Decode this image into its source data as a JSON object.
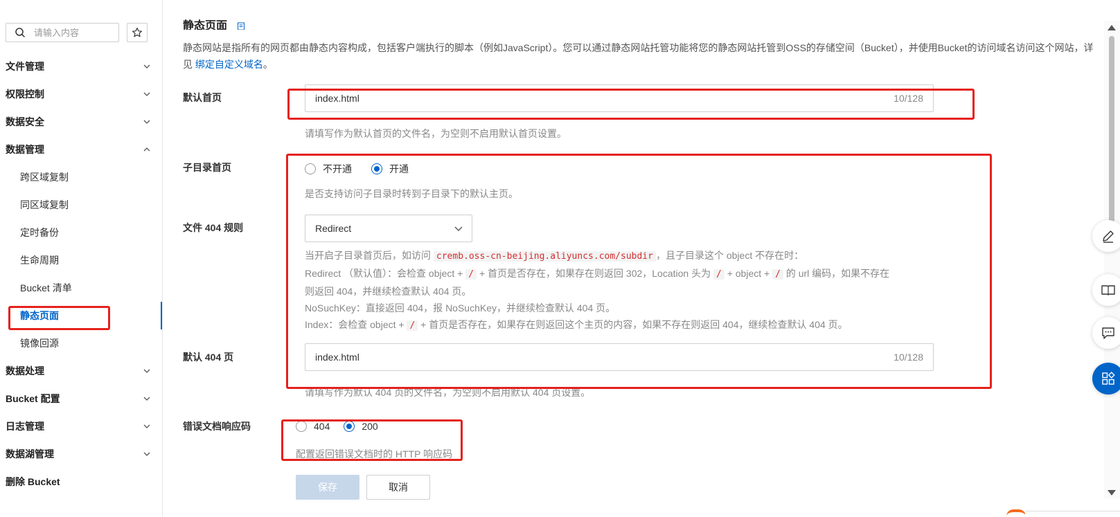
{
  "sidebar": {
    "search_placeholder": "请输入内容",
    "items": [
      {
        "label": "文件管理"
      },
      {
        "label": "权限控制"
      },
      {
        "label": "数据安全"
      },
      {
        "label": "数据管理"
      },
      {
        "label": "数据处理"
      },
      {
        "label": "Bucket 配置"
      },
      {
        "label": "日志管理"
      },
      {
        "label": "数据湖管理"
      },
      {
        "label": "删除 Bucket"
      }
    ],
    "sub_items": [
      {
        "label": "跨区域复制"
      },
      {
        "label": "同区域复制"
      },
      {
        "label": "定时备份"
      },
      {
        "label": "生命周期"
      },
      {
        "label": "Bucket 清单"
      },
      {
        "label": "静态页面"
      },
      {
        "label": "镜像回源"
      }
    ]
  },
  "main": {
    "section_title": "静态页面",
    "description_text": "静态网站是指所有的网页都由静态内容构成，包括客户端执行的脚本（例如JavaScript）。您可以通过静态网站托管功能将您的静态网站托管到OSS的存储空间（Bucket），并使用Bucket的访问域名访问这个网站，详见 ",
    "description_link": "绑定自定义域名",
    "description_end": "。",
    "default_index": {
      "label": "默认首页",
      "value": "index.html",
      "count": "10/128",
      "hint": "请填写作为默认首页的文件名，为空则不启用默认首页设置。"
    },
    "subdir_index": {
      "label": "子目录首页",
      "option_off": "不开通",
      "option_on": "开通",
      "hint": "是否支持访问子目录时转到子目录下的默认主页。"
    },
    "file_404_rule": {
      "label": "文件 404 规则",
      "selected": "Redirect",
      "line1_pre": "当开启子目录首页后，如访问",
      "line1_code": "cremb.oss-cn-beijing.aliyuncs.com/subdir",
      "line1_post": "，且子目录这个 object 不存在时：",
      "line2_a": "Redirect （默认值）：会检查 object +",
      "slash": "/",
      "line2_b": "+ 首页是否存在，如果存在则返回 302，Location 头为",
      "line2_c": "+ object +",
      "line2_d": "的 url 编码，如果不存在",
      "line3": "则返回 404，并继续检查默认 404 页。",
      "line4": "NoSuchKey：直接返回 404，报 NoSuchKey，并继续检查默认 404 页。",
      "line5_a": "Index：会检查 object +",
      "line5_b": "+ 首页是否存在，如果存在则返回这个主页的内容，如果不存在则返回 404，继续检查默认 404 页。"
    },
    "default_404": {
      "label": "默认 404 页",
      "value": "index.html",
      "count": "10/128",
      "hint": "请填写作为默认 404 页的文件名，为空则不启用默认 404 页设置。"
    },
    "error_code": {
      "label": "错误文档响应码",
      "option_404": "404",
      "option_200": "200",
      "hint": "配置返回错误文档时的 HTTP 响应码"
    },
    "save_label": "保存",
    "cancel_label": "取消"
  },
  "colors": {
    "accent": "#0064c8",
    "annotation_red": "#e5211c"
  }
}
